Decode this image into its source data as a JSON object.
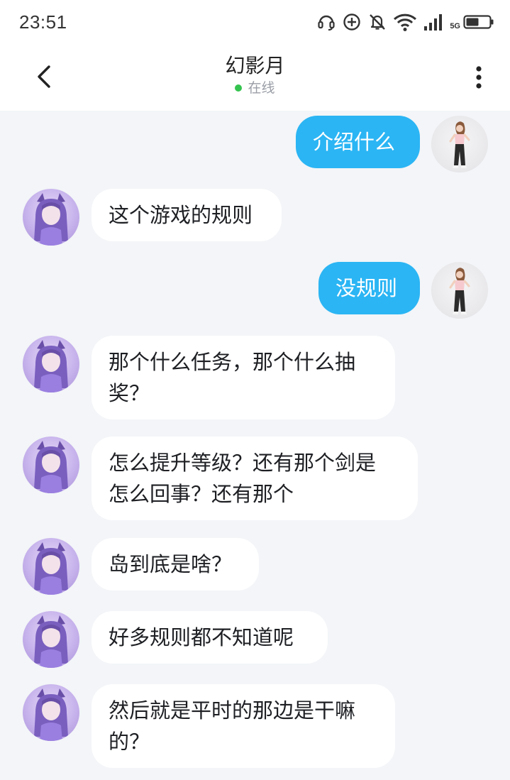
{
  "status_bar": {
    "time": "23:51",
    "network_label": "5G"
  },
  "header": {
    "title": "幻影月",
    "status": "在线",
    "status_color": "#35c34f"
  },
  "colors": {
    "outgoing_bubble": "#2bb5f4",
    "incoming_bubble": "#ffffff",
    "background": "#f3f5f8"
  },
  "messages": [
    {
      "direction": "out",
      "sender": "self",
      "text": "介绍什么"
    },
    {
      "direction": "in",
      "sender": "幻影月",
      "text": "这个游戏的规则"
    },
    {
      "direction": "out",
      "sender": "self",
      "text": "没规则"
    },
    {
      "direction": "in",
      "sender": "幻影月",
      "lines": [
        "那个什么任务，那个什么抽",
        "奖？"
      ]
    },
    {
      "direction": "in",
      "sender": "幻影月",
      "lines": [
        "怎么提升等级？还有那个剑是",
        "怎么回事？还有那个"
      ]
    },
    {
      "direction": "in",
      "sender": "幻影月",
      "text": "岛到底是啥？"
    },
    {
      "direction": "in",
      "sender": "幻影月",
      "text": "好多规则都不知道呢"
    },
    {
      "direction": "in",
      "sender": "幻影月",
      "lines": [
        "然后就是平时的那边是干嘛",
        "的？"
      ]
    }
  ],
  "icons": {
    "back": "chevron-left-icon",
    "more": "more-vertical-icon",
    "headset": "headset-icon",
    "add_circle": "add-circle-icon",
    "mute": "bell-off-icon",
    "wifi": "wifi-icon",
    "signal": "signal-icon",
    "battery": "battery-icon"
  }
}
